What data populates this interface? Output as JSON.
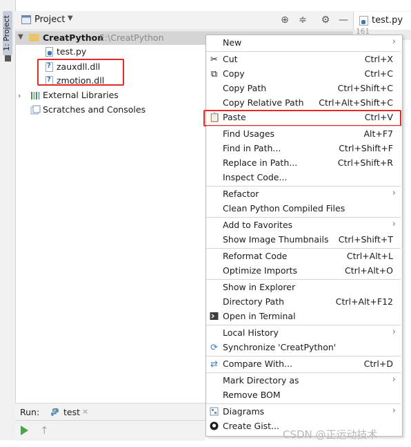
{
  "strip": {
    "label": "1: Project"
  },
  "header": {
    "title": "Project",
    "caret": "▼",
    "file_tab": "test.py",
    "line_number": "161"
  },
  "tree": {
    "root_name": "CreatPython",
    "root_path": "E:\\CreatPython",
    "items": [
      "test.py",
      "zauxdll.dll",
      "zmotion.dll"
    ],
    "external": "External Libraries",
    "scratches": "Scratches and Consoles"
  },
  "run": {
    "label": "Run:",
    "tab": "test",
    "close": "×"
  },
  "menu": {
    "items": [
      {
        "label": "New",
        "shortcut": ""
      },
      {
        "label": "Cut",
        "shortcut": "Ctrl+X"
      },
      {
        "label": "Copy",
        "shortcut": "Ctrl+C"
      },
      {
        "label": "Copy Path",
        "shortcut": "Ctrl+Shift+C"
      },
      {
        "label": "Copy Relative Path",
        "shortcut": "Ctrl+Alt+Shift+C"
      },
      {
        "label": "Paste",
        "shortcut": "Ctrl+V"
      },
      {
        "label": "Find Usages",
        "shortcut": "Alt+F7"
      },
      {
        "label": "Find in Path...",
        "shortcut": "Ctrl+Shift+F"
      },
      {
        "label": "Replace in Path...",
        "shortcut": "Ctrl+Shift+R"
      },
      {
        "label": "Inspect Code...",
        "shortcut": ""
      },
      {
        "label": "Refactor",
        "shortcut": ""
      },
      {
        "label": "Clean Python Compiled Files",
        "shortcut": ""
      },
      {
        "label": "Add to Favorites",
        "shortcut": ""
      },
      {
        "label": "Show Image Thumbnails",
        "shortcut": "Ctrl+Shift+T"
      },
      {
        "label": "Reformat Code",
        "shortcut": "Ctrl+Alt+L"
      },
      {
        "label": "Optimize Imports",
        "shortcut": "Ctrl+Alt+O"
      },
      {
        "label": "Show in Explorer",
        "shortcut": ""
      },
      {
        "label": "Directory Path",
        "shortcut": "Ctrl+Alt+F12"
      },
      {
        "label": "Open in Terminal",
        "shortcut": ""
      },
      {
        "label": "Local History",
        "shortcut": ""
      },
      {
        "label": "Synchronize 'CreatPython'",
        "shortcut": ""
      },
      {
        "label": "Compare With...",
        "shortcut": "Ctrl+D"
      },
      {
        "label": "Mark Directory as",
        "shortcut": ""
      },
      {
        "label": "Remove BOM",
        "shortcut": ""
      },
      {
        "label": "Diagrams",
        "shortcut": ""
      },
      {
        "label": "Create Gist...",
        "shortcut": ""
      }
    ]
  },
  "watermark": "CSDN @正运动技术",
  "colors": {
    "highlight_border": "#e8262a",
    "selected_row": "#d5d5d5"
  }
}
